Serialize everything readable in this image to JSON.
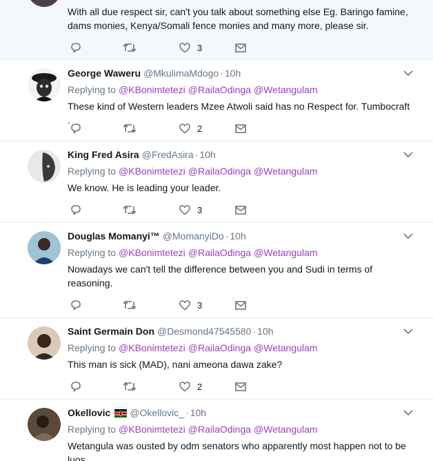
{
  "tweets": [
    {
      "text": "With all due respect sir,  can't you talk about something else Eg. Baringo famine, dams monies, Kenya/Somali fence monies and many more, please sir.",
      "likes": "3"
    },
    {
      "name": "George Waweru",
      "handle": "@MkulimaMdogo",
      "time": "10h",
      "replying_label": "Replying to",
      "mentions": [
        "@KBonimtetezi",
        "@RailaOdinga",
        "@Wetangulam"
      ],
      "text": "These kind of Western leaders Mzee Atwoli said has no Respect for. Tumbocraft .",
      "likes": "2"
    },
    {
      "name": "King Fred Asira",
      "handle": "@FredAsira",
      "time": "10h",
      "replying_label": "Replying to",
      "mentions": [
        "@KBonimtetezi",
        "@RailaOdinga",
        "@Wetangulam"
      ],
      "text": "We know. He is leading your leader.",
      "likes": "3"
    },
    {
      "name": "Douglas Momanyi™",
      "handle": "@MomanyiDo",
      "time": "10h",
      "replying_label": "Replying to",
      "mentions": [
        "@KBonimtetezi",
        "@RailaOdinga",
        "@Wetangulam"
      ],
      "text": "Nowadays we can't tell the difference between you and Sudi in terms of reasoning.",
      "likes": "3"
    },
    {
      "name": "Saint Germain Don",
      "handle": "@Desmond47545580",
      "time": "10h",
      "replying_label": "Replying to",
      "mentions": [
        "@KBonimtetezi",
        "@RailaOdinga",
        "@Wetangulam"
      ],
      "text": "This man is sick  (MAD), nani ameona dawa zake?",
      "likes": "2"
    },
    {
      "name": "Okellovic",
      "handle": "@Okellovic_",
      "time": "10h",
      "replying_label": "Replying to",
      "mentions": [
        "@KBonimtetezi",
        "@RailaOdinga",
        "@Wetangulam"
      ],
      "text": "Wetangula was ousted by odm senators who apparently most happen not to be luos",
      "likes": ""
    }
  ],
  "colors": {
    "mention": "#9c3ec1",
    "muted": "#657786",
    "divider": "#e6ecf0"
  },
  "icons": [
    "reply-icon",
    "retweet-icon",
    "like-icon",
    "direct-message-icon",
    "chevron-down-icon",
    "kenya-flag-icon"
  ]
}
